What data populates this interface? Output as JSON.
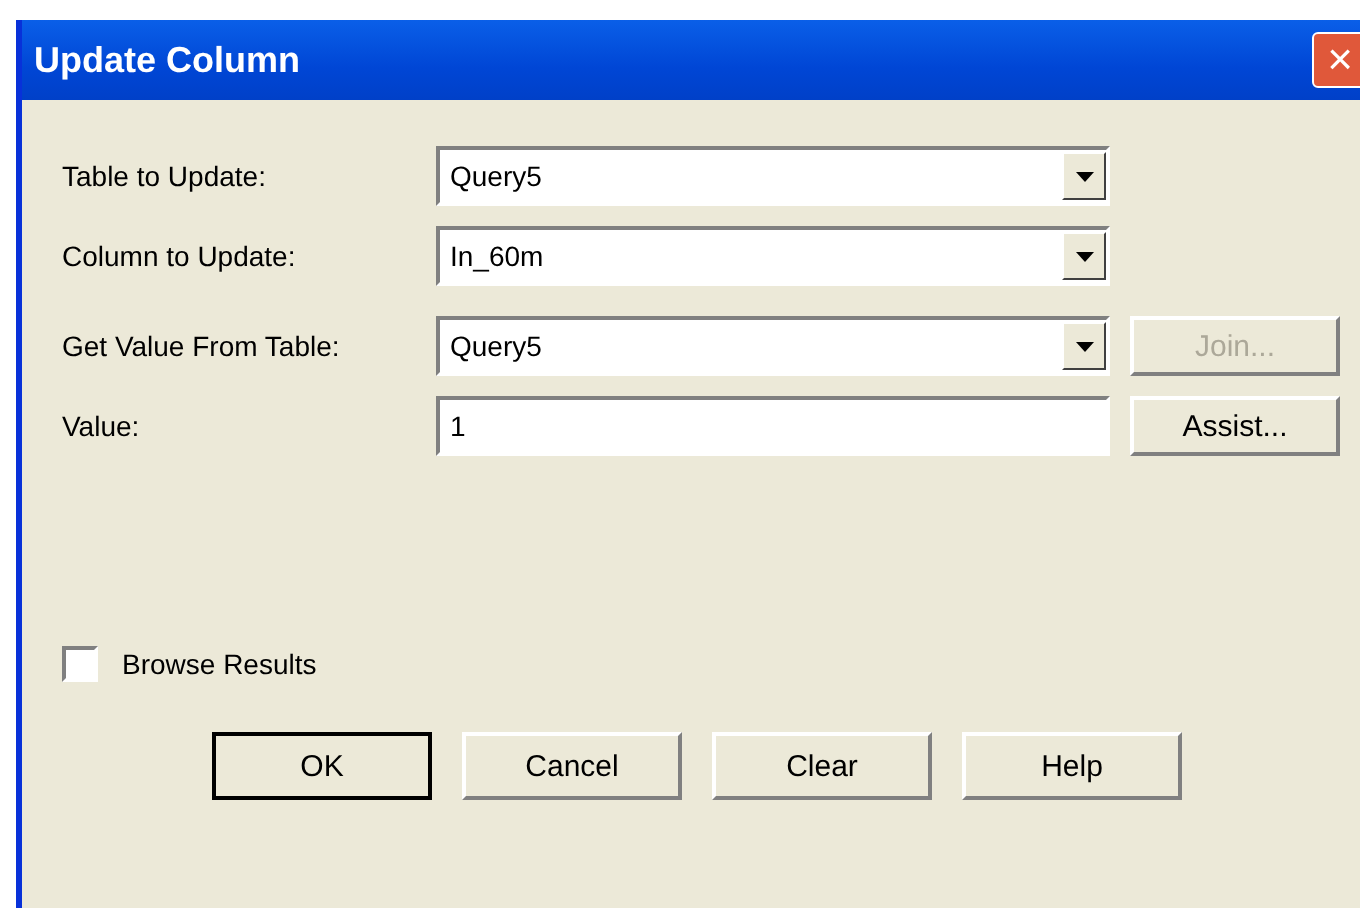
{
  "window": {
    "title": "Update Column",
    "close": "×"
  },
  "fields": [
    {
      "label": "Table to Update:",
      "kind": "dropdown",
      "value": "Query5"
    },
    {
      "label": "Column to Update:",
      "kind": "dropdown",
      "value": "In_60m"
    },
    {
      "label": "Get Value From Table:",
      "kind": "dropdown",
      "value": "Query5",
      "button": {
        "label": "Join...",
        "disabled": true
      }
    },
    {
      "label": "Value:",
      "kind": "text",
      "value": "1",
      "button": {
        "label": "Assist...",
        "disabled": false
      }
    }
  ],
  "browse_results": {
    "label": "Browse Results",
    "checked": false
  },
  "buttons": [
    {
      "label": "OK",
      "default": true
    },
    {
      "label": "Cancel",
      "default": false
    },
    {
      "label": "Clear",
      "default": false
    },
    {
      "label": "Help",
      "default": false
    }
  ]
}
